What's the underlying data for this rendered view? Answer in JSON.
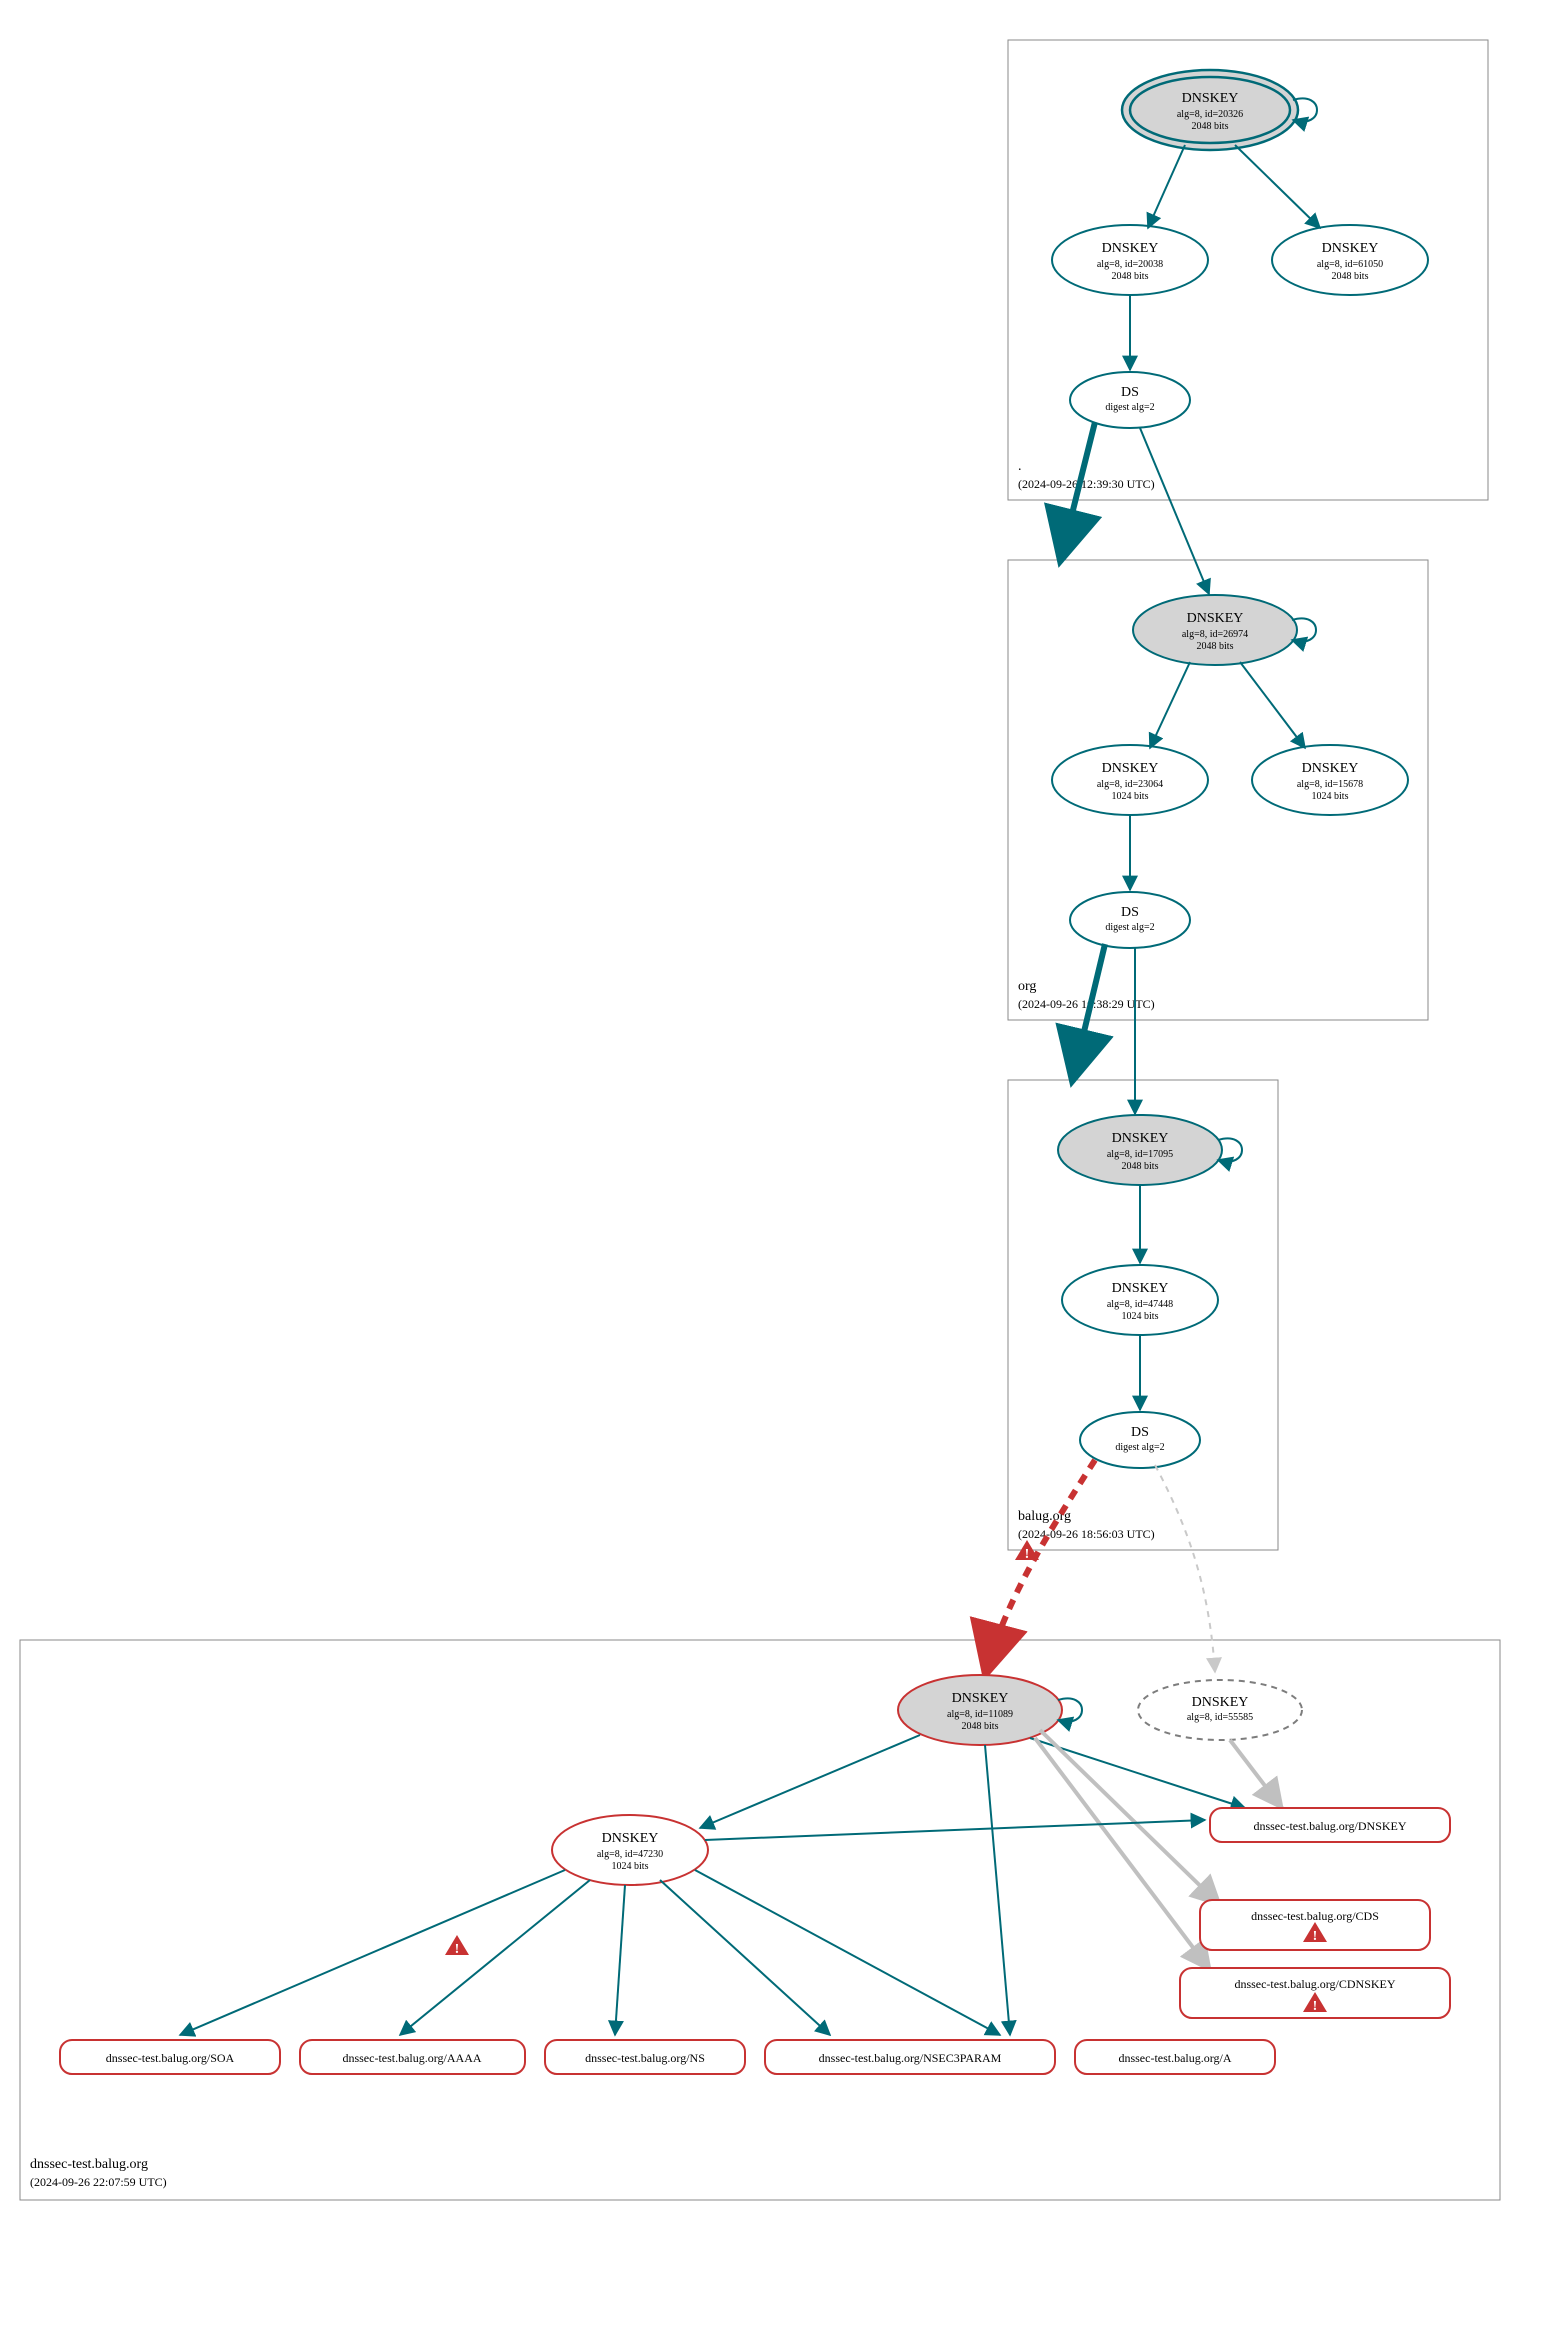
{
  "colors": {
    "teal": "#006a77",
    "grey": "#5c5c5c",
    "lightgrey": "#c9c9c9",
    "red": "#c83232",
    "box": "#8a8a8a",
    "nodefill_grey": "#d4d4d4",
    "nodefill_white": "#ffffff"
  },
  "zones": {
    "root": {
      "label": ".",
      "ts": "(2024-09-26 12:39:30 UTC)"
    },
    "org": {
      "label": "org",
      "ts": "(2024-09-26 16:38:29 UTC)"
    },
    "balug": {
      "label": "balug.org",
      "ts": "(2024-09-26 18:56:03 UTC)"
    },
    "test": {
      "label": "dnssec-test.balug.org",
      "ts": "(2024-09-26 22:07:59 UTC)"
    }
  },
  "nodes": {
    "root_ksk": {
      "title": "DNSKEY",
      "l1": "alg=8, id=20326",
      "l2": "2048 bits"
    },
    "root_zsk": {
      "title": "DNSKEY",
      "l1": "alg=8, id=20038",
      "l2": "2048 bits"
    },
    "root_extra": {
      "title": "DNSKEY",
      "l1": "alg=8, id=61050",
      "l2": "2048 bits"
    },
    "root_ds": {
      "title": "DS",
      "l1": "digest alg=2"
    },
    "org_ksk": {
      "title": "DNSKEY",
      "l1": "alg=8, id=26974",
      "l2": "2048 bits"
    },
    "org_zsk": {
      "title": "DNSKEY",
      "l1": "alg=8, id=23064",
      "l2": "1024 bits"
    },
    "org_extra": {
      "title": "DNSKEY",
      "l1": "alg=8, id=15678",
      "l2": "1024 bits"
    },
    "org_ds": {
      "title": "DS",
      "l1": "digest alg=2"
    },
    "balug_ksk": {
      "title": "DNSKEY",
      "l1": "alg=8, id=17095",
      "l2": "2048 bits"
    },
    "balug_zsk": {
      "title": "DNSKEY",
      "l1": "alg=8, id=47448",
      "l2": "1024 bits"
    },
    "balug_ds": {
      "title": "DS",
      "l1": "digest alg=2"
    },
    "test_ksk": {
      "title": "DNSKEY",
      "l1": "alg=8, id=11089",
      "l2": "2048 bits"
    },
    "test_dashed": {
      "title": "DNSKEY",
      "l1": "alg=8, id=55585"
    },
    "test_zsk": {
      "title": "DNSKEY",
      "l1": "alg=8, id=47230",
      "l2": "1024 bits"
    }
  },
  "records": {
    "soa": "dnssec-test.balug.org/SOA",
    "aaaa": "dnssec-test.balug.org/AAAA",
    "ns": "dnssec-test.balug.org/NS",
    "nsec3": "dnssec-test.balug.org/NSEC3PARAM",
    "a": "dnssec-test.balug.org/A",
    "dnskey": "dnssec-test.balug.org/DNSKEY",
    "cds": "dnssec-test.balug.org/CDS",
    "cdnskey": "dnssec-test.balug.org/CDNSKEY"
  }
}
